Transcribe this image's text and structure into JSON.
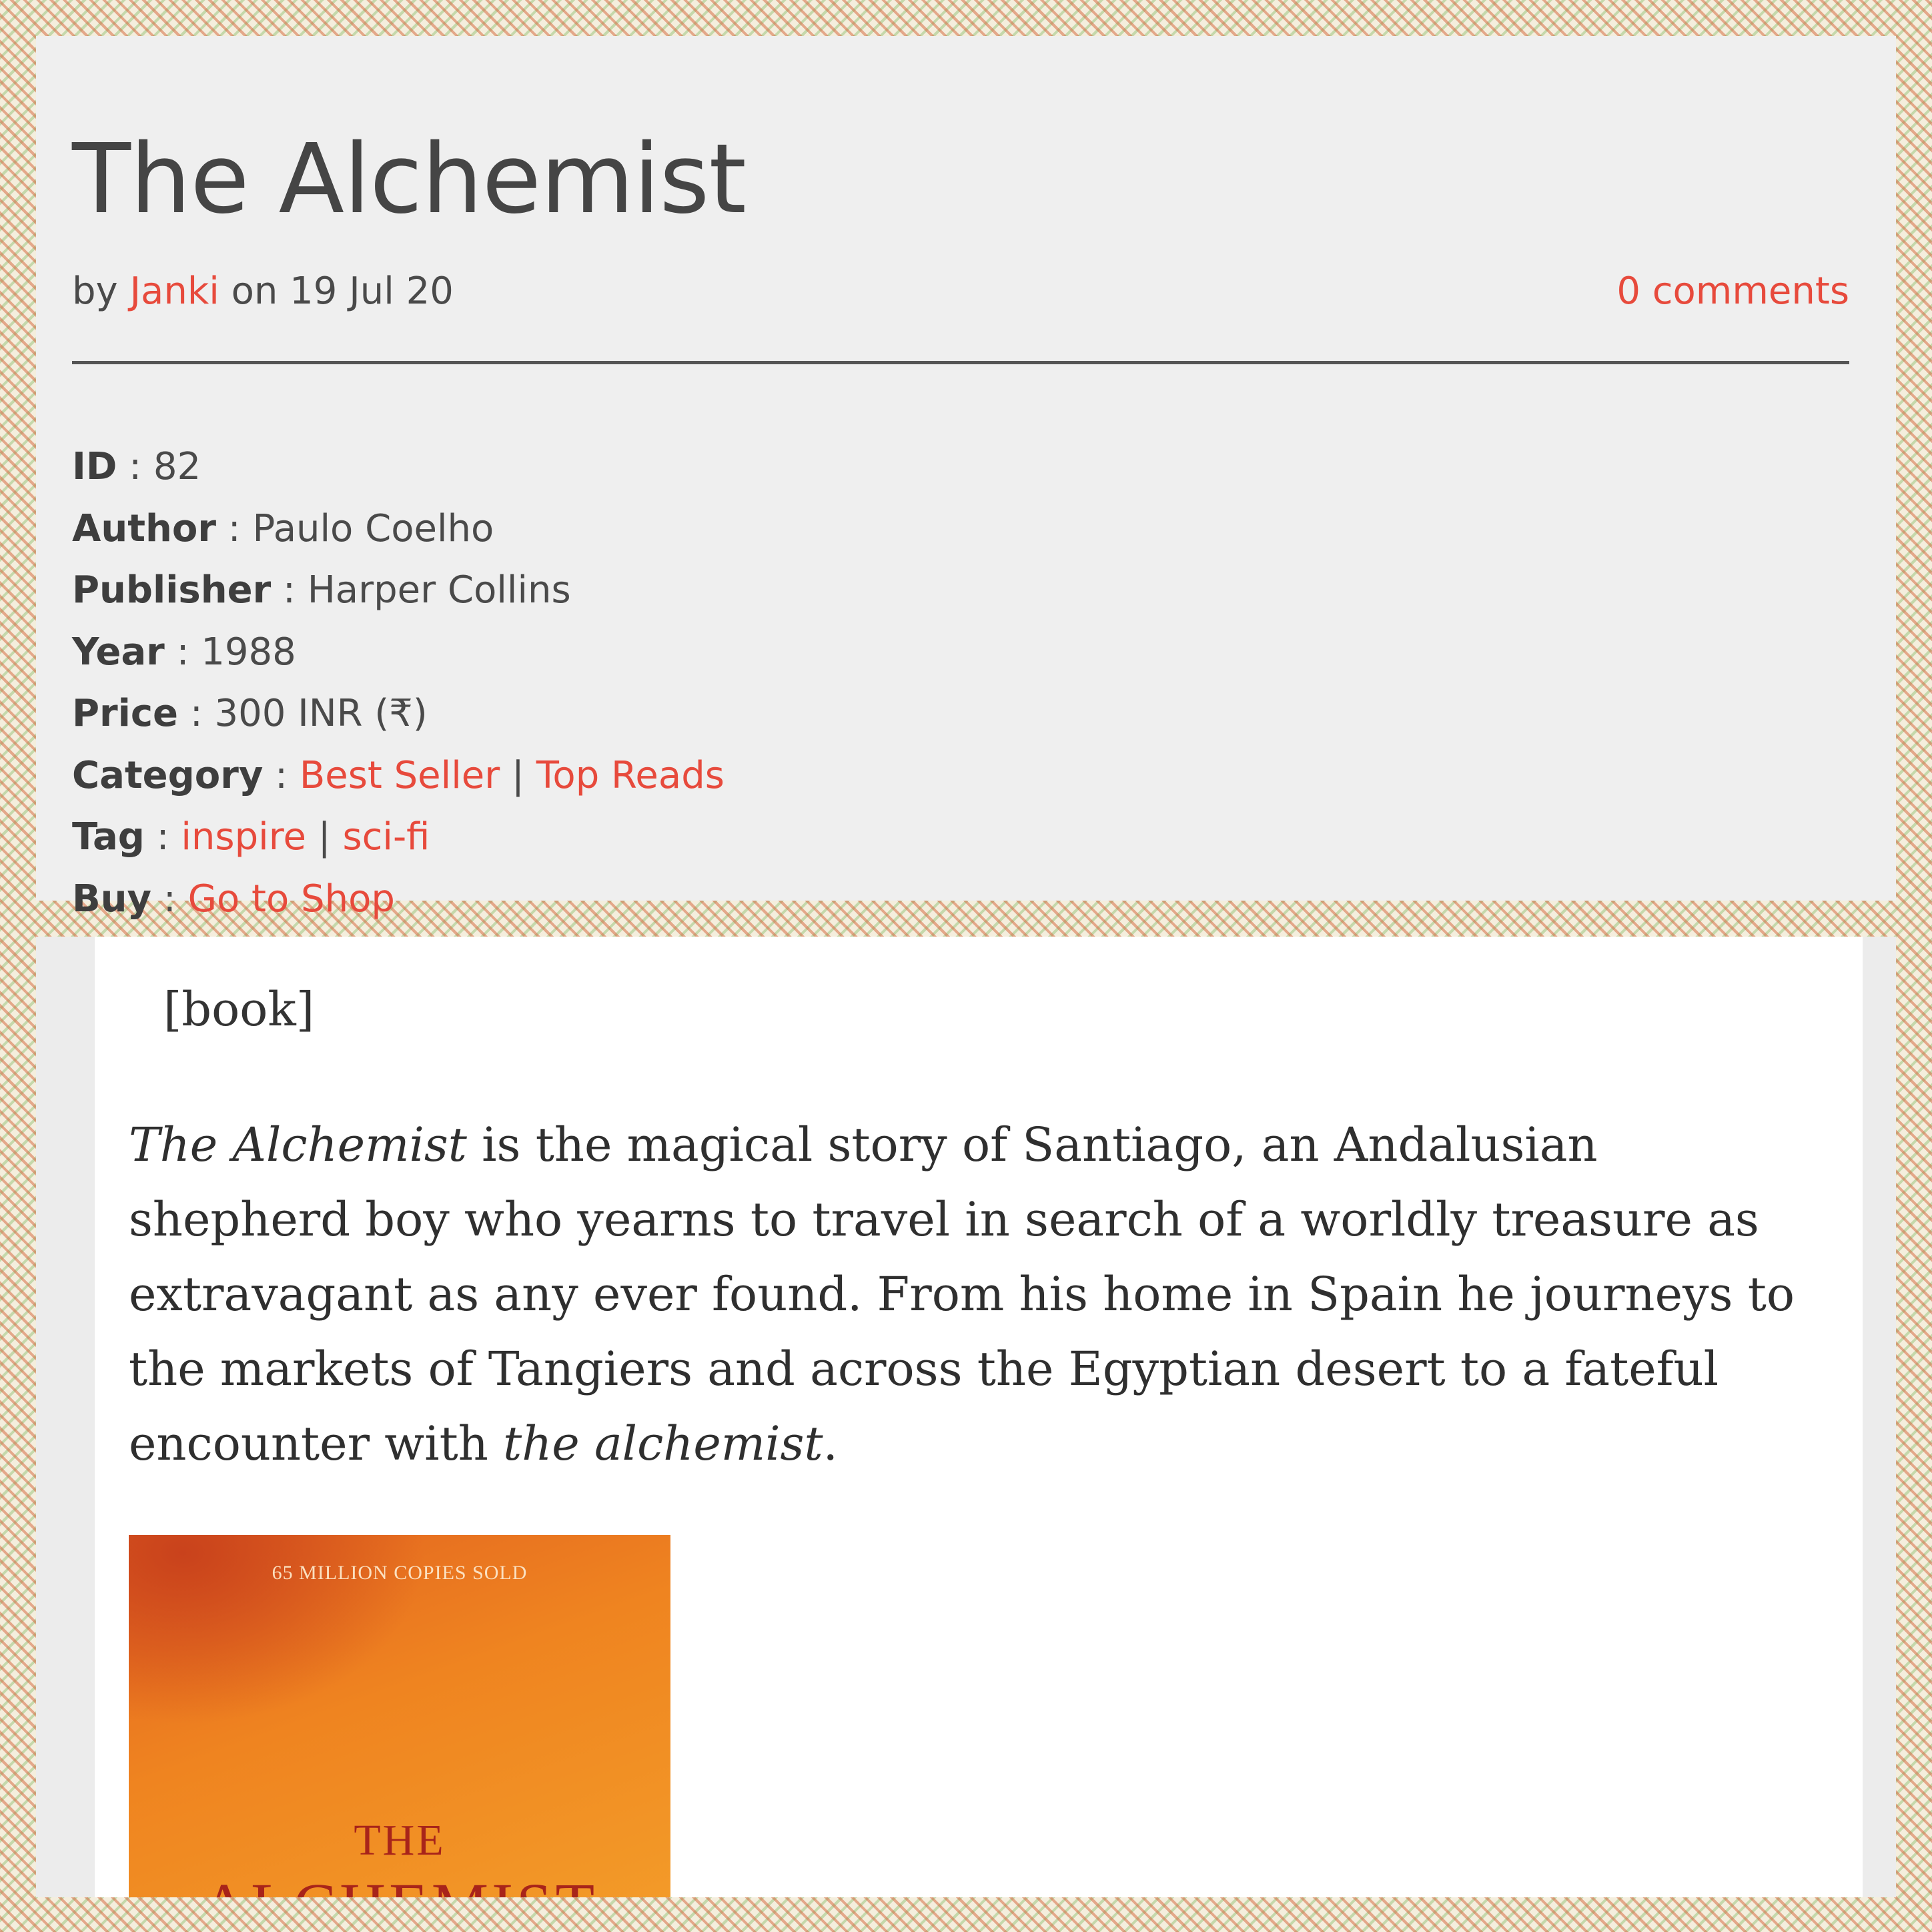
{
  "post": {
    "title": "The Alchemist",
    "by_label": "by",
    "author_name": "Janki",
    "date_text": "on 19 Jul 20",
    "comments": "0 comments"
  },
  "book_info": {
    "id": {
      "label": "ID",
      "value": "82"
    },
    "author": {
      "label": "Author",
      "value": "Paulo Coelho"
    },
    "publisher": {
      "label": "Publisher",
      "value": "Harper Collins"
    },
    "year": {
      "label": "Year",
      "value": "1988"
    },
    "price": {
      "label": "Price",
      "value": "300 INR (₹)"
    },
    "category": {
      "label": "Category",
      "items": [
        "Best Seller",
        "Top Reads"
      ]
    },
    "tag": {
      "label": "Tag",
      "items": [
        "inspire",
        "sci-fi"
      ]
    },
    "buy": {
      "label": "Buy",
      "link": "Go to Shop"
    },
    "separator": ":",
    "pipe": "|"
  },
  "content": {
    "shortcode": "[book]",
    "description": {
      "em_start": "The Alchemist",
      "text": " is the magical story of Santiago, an Andalusian shepherd boy who yearns to travel in search of a worldly treasure as extravagant as any ever found. From his home in Spain he journeys to the markets of Tangiers and across the Egyptian desert to a fateful encounter with ",
      "em_end": "the alchemist",
      "end": "."
    },
    "cover": {
      "tagline": "65 MILLION COPIES SOLD",
      "title_line1": "THE",
      "title_line2": "ALCHEMIST"
    }
  },
  "colors": {
    "link": "#e74a3c",
    "text": "#4a4a4a",
    "panel": "#efefef"
  }
}
